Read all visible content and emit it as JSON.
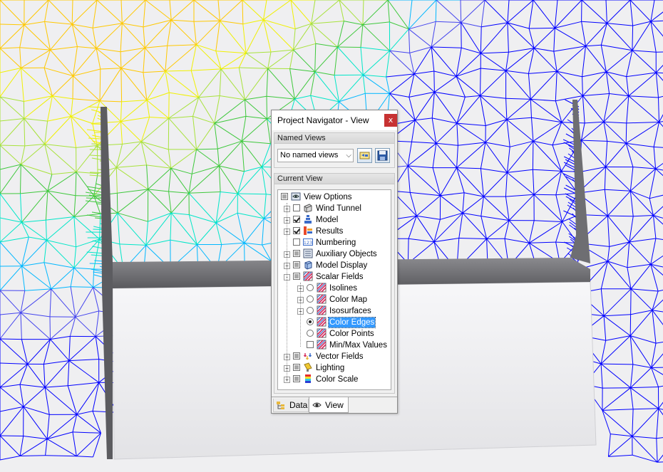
{
  "panel": {
    "title": "Project Navigator - View",
    "close_label": "x",
    "named_views": {
      "header": "Named Views",
      "selected": "No named views",
      "colors": {
        "button_bg": "#d8e4f0",
        "button_border": "#7f9db9"
      }
    },
    "current_view": {
      "header": "Current View"
    },
    "tabs": [
      {
        "label": "Data"
      },
      {
        "label": "View"
      }
    ]
  },
  "tree": [
    {
      "label": "View Options",
      "control": "partial",
      "icon": "view-options-icon"
    },
    {
      "label": "Wind Tunnel",
      "control": "unchecked",
      "icon": "wind-tunnel-icon"
    },
    {
      "label": "Model",
      "control": "checked",
      "icon": "model-icon"
    },
    {
      "label": "Results",
      "control": "checked",
      "icon": "results-icon"
    },
    {
      "label": "Numbering",
      "control": "unchecked",
      "icon": "numbering-icon",
      "icon_text": "123"
    },
    {
      "label": "Auxiliary Objects",
      "control": "partial",
      "icon": "auxiliary-objects-icon"
    },
    {
      "label": "Model Display",
      "control": "partial",
      "icon": "model-display-icon"
    },
    {
      "label": "Scalar Fields",
      "control": "partial",
      "icon": "scalar-fields-icon"
    },
    {
      "label": "Isolines",
      "control": "radio-off",
      "icon": "isolines-icon"
    },
    {
      "label": "Color Map",
      "control": "radio-off",
      "icon": "color-map-icon"
    },
    {
      "label": "Isosurfaces",
      "control": "radio-off",
      "icon": "isosurfaces-icon"
    },
    {
      "label": "Color Edges",
      "control": "radio-on",
      "icon": "color-edges-icon",
      "selected": true
    },
    {
      "label": "Color Points",
      "control": "radio-off",
      "icon": "color-points-icon"
    },
    {
      "label": "Min/Max Values",
      "control": "unchecked",
      "icon": "min-max-values-icon"
    },
    {
      "label": "Vector Fields",
      "control": "partial",
      "icon": "vector-fields-icon"
    },
    {
      "label": "Lighting",
      "control": "partial",
      "icon": "lighting-icon"
    },
    {
      "label": "Color Scale",
      "control": "partial",
      "icon": "color-scale-icon"
    }
  ],
  "colors": {
    "selection": "#3399ff",
    "close_button": "#c73232",
    "mesh_palette": [
      "#0000ff",
      "#4444ee",
      "#00b7ff",
      "#00e6c8",
      "#3ec83c",
      "#a8e23c",
      "#f0f000",
      "#ffc800"
    ],
    "model_body": "#f3f3f5",
    "model_wall": "#6a6a6e"
  }
}
